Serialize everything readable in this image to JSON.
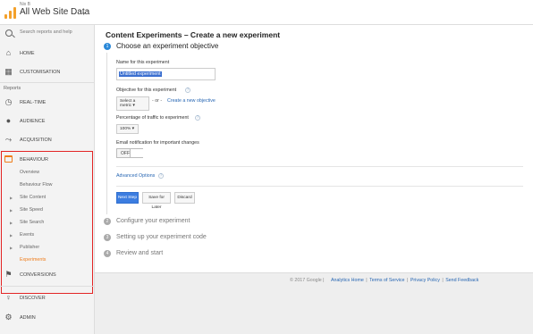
{
  "header": {
    "account_small": "Nix B",
    "account_name": "All Web Site Data",
    "caret": "▾"
  },
  "sidebar": {
    "search_placeholder": "Search reports and help",
    "home": "HOME",
    "customisation": "CUSTOMISATION",
    "reports_label": "Reports",
    "realtime": "REAL-TIME",
    "audience": "AUDIENCE",
    "acquisition": "ACQUISITION",
    "behaviour": "BEHAVIOUR",
    "behaviour_items": [
      {
        "label": "Overview",
        "arrow": ""
      },
      {
        "label": "Behaviour Flow",
        "arrow": ""
      },
      {
        "label": "Site Content",
        "arrow": "▶"
      },
      {
        "label": "Site Speed",
        "arrow": "▶"
      },
      {
        "label": "Site Search",
        "arrow": "▶"
      },
      {
        "label": "Events",
        "arrow": "▶"
      },
      {
        "label": "Publisher",
        "arrow": "▶"
      },
      {
        "label": "Experiments",
        "arrow": ""
      }
    ],
    "conversions": "CONVERSIONS",
    "discover": "DISCOVER",
    "admin": "ADMIN"
  },
  "main": {
    "title": "Content Experiments – Create a new experiment",
    "steps": [
      {
        "number": "1",
        "label": "Choose an experiment objective"
      },
      {
        "number": "2",
        "label": "Configure your experiment"
      },
      {
        "number": "3",
        "label": "Setting up your experiment code"
      },
      {
        "number": "4",
        "label": "Review and start"
      }
    ],
    "name_label": "Name for this experiment",
    "name_value": "Untitled experiment",
    "objective_label": "Objective for this experiment",
    "objective_select": "Select a metric ▾",
    "or_text": "- or -",
    "create_objective_link": "Create a new objective",
    "traffic_label": "Percentage of traffic to experiment",
    "traffic_select": "100% ▾",
    "email_label": "Email notification for important changes",
    "toggle_state": "OFF",
    "advanced_options": "Advanced Options",
    "next_step": "Next Step",
    "save_later": "Save for Later",
    "discard": "Discard",
    "help_glyph": "?"
  },
  "footer": {
    "copyright": "© 2017 Google |",
    "links": [
      "Analytics Home",
      "Terms of Service",
      "Privacy Policy",
      "Send Feedback"
    ],
    "separator": "|"
  },
  "colors": {
    "accent_orange": "#ef7d1b",
    "highlight_red": "#e32424",
    "primary_blue": "#3c7de0",
    "link_blue": "#2766b3"
  }
}
